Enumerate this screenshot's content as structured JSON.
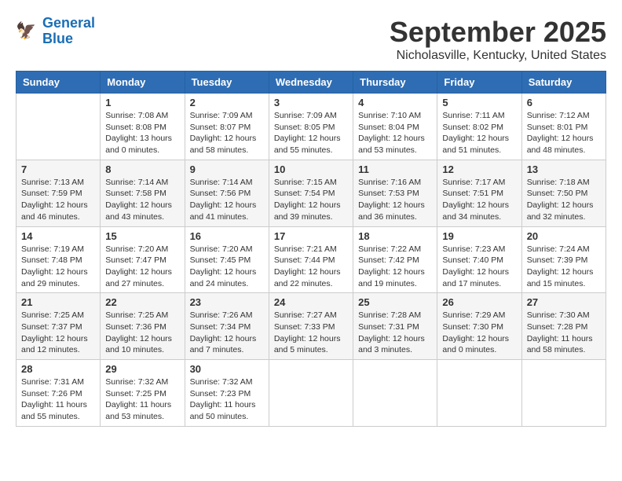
{
  "header": {
    "logo_line1": "General",
    "logo_line2": "Blue",
    "month": "September 2025",
    "location": "Nicholasville, Kentucky, United States"
  },
  "weekdays": [
    "Sunday",
    "Monday",
    "Tuesday",
    "Wednesday",
    "Thursday",
    "Friday",
    "Saturday"
  ],
  "weeks": [
    [
      {
        "day": "",
        "info": ""
      },
      {
        "day": "1",
        "info": "Sunrise: 7:08 AM\nSunset: 8:08 PM\nDaylight: 13 hours\nand 0 minutes."
      },
      {
        "day": "2",
        "info": "Sunrise: 7:09 AM\nSunset: 8:07 PM\nDaylight: 12 hours\nand 58 minutes."
      },
      {
        "day": "3",
        "info": "Sunrise: 7:09 AM\nSunset: 8:05 PM\nDaylight: 12 hours\nand 55 minutes."
      },
      {
        "day": "4",
        "info": "Sunrise: 7:10 AM\nSunset: 8:04 PM\nDaylight: 12 hours\nand 53 minutes."
      },
      {
        "day": "5",
        "info": "Sunrise: 7:11 AM\nSunset: 8:02 PM\nDaylight: 12 hours\nand 51 minutes."
      },
      {
        "day": "6",
        "info": "Sunrise: 7:12 AM\nSunset: 8:01 PM\nDaylight: 12 hours\nand 48 minutes."
      }
    ],
    [
      {
        "day": "7",
        "info": "Sunrise: 7:13 AM\nSunset: 7:59 PM\nDaylight: 12 hours\nand 46 minutes."
      },
      {
        "day": "8",
        "info": "Sunrise: 7:14 AM\nSunset: 7:58 PM\nDaylight: 12 hours\nand 43 minutes."
      },
      {
        "day": "9",
        "info": "Sunrise: 7:14 AM\nSunset: 7:56 PM\nDaylight: 12 hours\nand 41 minutes."
      },
      {
        "day": "10",
        "info": "Sunrise: 7:15 AM\nSunset: 7:54 PM\nDaylight: 12 hours\nand 39 minutes."
      },
      {
        "day": "11",
        "info": "Sunrise: 7:16 AM\nSunset: 7:53 PM\nDaylight: 12 hours\nand 36 minutes."
      },
      {
        "day": "12",
        "info": "Sunrise: 7:17 AM\nSunset: 7:51 PM\nDaylight: 12 hours\nand 34 minutes."
      },
      {
        "day": "13",
        "info": "Sunrise: 7:18 AM\nSunset: 7:50 PM\nDaylight: 12 hours\nand 32 minutes."
      }
    ],
    [
      {
        "day": "14",
        "info": "Sunrise: 7:19 AM\nSunset: 7:48 PM\nDaylight: 12 hours\nand 29 minutes."
      },
      {
        "day": "15",
        "info": "Sunrise: 7:20 AM\nSunset: 7:47 PM\nDaylight: 12 hours\nand 27 minutes."
      },
      {
        "day": "16",
        "info": "Sunrise: 7:20 AM\nSunset: 7:45 PM\nDaylight: 12 hours\nand 24 minutes."
      },
      {
        "day": "17",
        "info": "Sunrise: 7:21 AM\nSunset: 7:44 PM\nDaylight: 12 hours\nand 22 minutes."
      },
      {
        "day": "18",
        "info": "Sunrise: 7:22 AM\nSunset: 7:42 PM\nDaylight: 12 hours\nand 19 minutes."
      },
      {
        "day": "19",
        "info": "Sunrise: 7:23 AM\nSunset: 7:40 PM\nDaylight: 12 hours\nand 17 minutes."
      },
      {
        "day": "20",
        "info": "Sunrise: 7:24 AM\nSunset: 7:39 PM\nDaylight: 12 hours\nand 15 minutes."
      }
    ],
    [
      {
        "day": "21",
        "info": "Sunrise: 7:25 AM\nSunset: 7:37 PM\nDaylight: 12 hours\nand 12 minutes."
      },
      {
        "day": "22",
        "info": "Sunrise: 7:25 AM\nSunset: 7:36 PM\nDaylight: 12 hours\nand 10 minutes."
      },
      {
        "day": "23",
        "info": "Sunrise: 7:26 AM\nSunset: 7:34 PM\nDaylight: 12 hours\nand 7 minutes."
      },
      {
        "day": "24",
        "info": "Sunrise: 7:27 AM\nSunset: 7:33 PM\nDaylight: 12 hours\nand 5 minutes."
      },
      {
        "day": "25",
        "info": "Sunrise: 7:28 AM\nSunset: 7:31 PM\nDaylight: 12 hours\nand 3 minutes."
      },
      {
        "day": "26",
        "info": "Sunrise: 7:29 AM\nSunset: 7:30 PM\nDaylight: 12 hours\nand 0 minutes."
      },
      {
        "day": "27",
        "info": "Sunrise: 7:30 AM\nSunset: 7:28 PM\nDaylight: 11 hours\nand 58 minutes."
      }
    ],
    [
      {
        "day": "28",
        "info": "Sunrise: 7:31 AM\nSunset: 7:26 PM\nDaylight: 11 hours\nand 55 minutes."
      },
      {
        "day": "29",
        "info": "Sunrise: 7:32 AM\nSunset: 7:25 PM\nDaylight: 11 hours\nand 53 minutes."
      },
      {
        "day": "30",
        "info": "Sunrise: 7:32 AM\nSunset: 7:23 PM\nDaylight: 11 hours\nand 50 minutes."
      },
      {
        "day": "",
        "info": ""
      },
      {
        "day": "",
        "info": ""
      },
      {
        "day": "",
        "info": ""
      },
      {
        "day": "",
        "info": ""
      }
    ]
  ]
}
